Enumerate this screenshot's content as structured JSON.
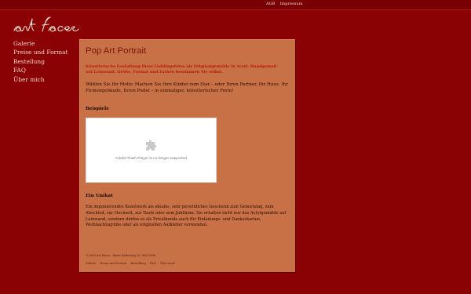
{
  "top_links": [
    "AGB",
    "Impressum"
  ],
  "nav": [
    "Galerie",
    "Preise und Format",
    "Bestellung",
    "FAQ",
    "Über mich"
  ],
  "content": {
    "title": "Pop Art Portrait",
    "lead": "Künstlerische Gestaltung Ihres Lieblingsfotos als Originalgemälde in Acryl. Handgemalt auf Leinwand. Größe, Format und Farben bestimmen Sie selbst.",
    "intro": "Wählen Sie Ihr Motiv. Machen Sie Ihre Kinder zum Star – oder Ihren Partner, Ihr Haus, Ihr Firmengebäude, Ihren Pudel – in einmaliger, künstlerischer Form!",
    "examples_heading": "Beispiele",
    "flash_text": "Adobe Flash Player is no longer supported",
    "unikat_heading": "Ein Unikat",
    "unikat_text": "Ein imponierendes Kunstwerk als ideales, sehr persönliches Geschenk zum Geburtstag, zum Abschied, zur Hochzeit, zur Taufe oder zum Jubiläum. Sie erhalten nicht nur das Acrylgemälde auf Leinwand, sondern dürfen es als Privatkunde auch für Einladungs- und Dankeskarten, Weihnachtsgrüße oder als originellen Aufkleber verwenden.",
    "footer": "©2006 Art Faces  ·  letzte Änderung 19. Mai 2006.",
    "footer_links": [
      "Galerie",
      "Preise und Format",
      "Bestellung",
      "FAQ",
      "Über mich"
    ]
  },
  "colors": {
    "background": "#8a0204",
    "panel": "#c87147",
    "title": "#7a1208",
    "lead": "#b5170a"
  },
  "icons": {
    "logo": "art-faces-script-logo",
    "flash_placeholder": "puzzle-piece-icon"
  }
}
